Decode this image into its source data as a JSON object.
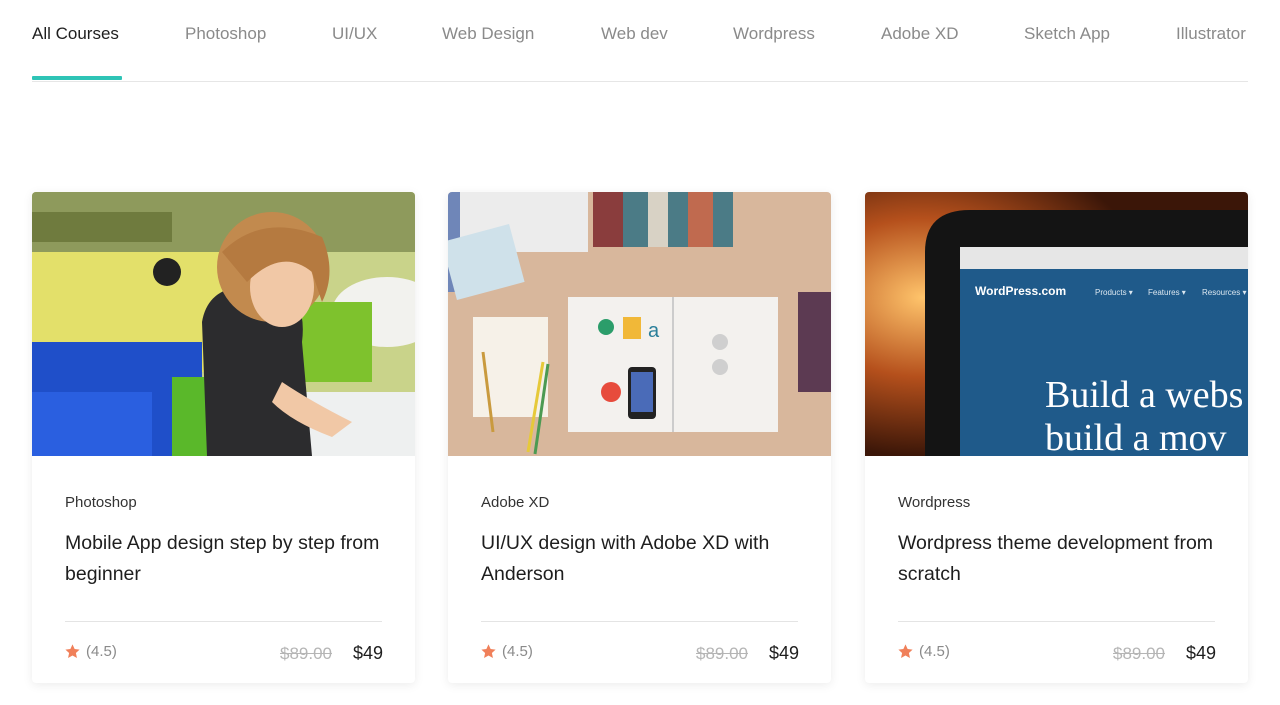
{
  "tabs": [
    {
      "label": "All Courses",
      "active": true
    },
    {
      "label": "Photoshop",
      "active": false
    },
    {
      "label": "UI/UX",
      "active": false
    },
    {
      "label": "Web Design",
      "active": false
    },
    {
      "label": "Web dev",
      "active": false
    },
    {
      "label": "Wordpress",
      "active": false
    },
    {
      "label": "Adobe XD",
      "active": false
    },
    {
      "label": "Sketch App",
      "active": false
    },
    {
      "label": "Illustrator",
      "active": false
    }
  ],
  "accent_color": "#2ec4b6",
  "star_color": "#f0805a",
  "courses": [
    {
      "category": "Photoshop",
      "title": "Mobile App design step by step from beginner",
      "rating": "(4.5)",
      "old_price": "$89.00",
      "price": "$49",
      "image": "child-drawing-photo"
    },
    {
      "category": "Adobe XD",
      "title": "UI/UX design with Adobe XD with Anderson",
      "rating": "(4.5)",
      "old_price": "$89.00",
      "price": "$49",
      "image": "design-desk-photo"
    },
    {
      "category": "Wordpress",
      "title": "Wordpress theme development from scratch",
      "rating": "(4.5)",
      "old_price": "$89.00",
      "price": "$49",
      "image": "laptop-wordpress-photo",
      "image_text": {
        "logo": "WordPress.com",
        "nav": [
          "Products ▾",
          "Features ▾",
          "Resources ▾"
        ],
        "headline_1": "Build a webs",
        "headline_2": "build a mov"
      }
    }
  ]
}
